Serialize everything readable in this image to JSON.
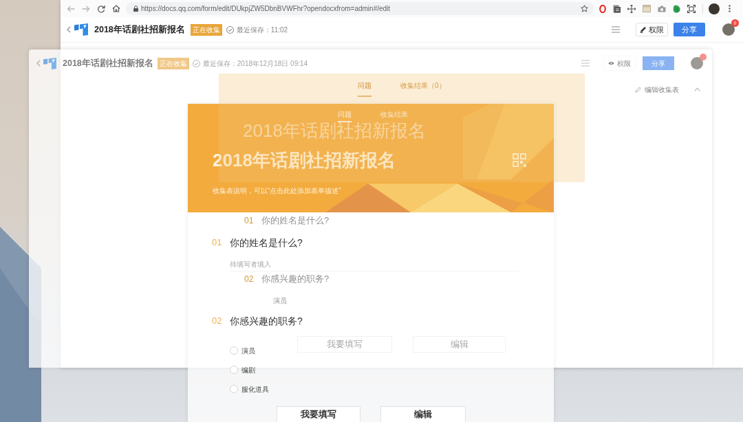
{
  "browser": {
    "url": "https://docs.qq.com/form/edit/DUkpjZW5DbnBVWFhr?opendocxfrom=admin#/edit"
  },
  "doc_header": {
    "title": "2018年话剧社招新报名",
    "badge": "正在收集",
    "save_status": "最近保存：11:02",
    "permission_button": "权限",
    "share_button": "分享",
    "notification_count": "0"
  },
  "previous_view": {
    "header": {
      "title": "2018年话剧社招新报名",
      "badge": "正在收集",
      "save_status": "最近保存：2018年12月18日 09:14",
      "permission_button": "权限",
      "share_button": "分享"
    },
    "edit_link": "编辑收集表",
    "tabs": [
      {
        "label": "问题",
        "selected": true
      },
      {
        "label": "收集结果（0）",
        "selected": false
      }
    ],
    "form_title": "2018年话剧社招新报名",
    "questions": [
      {
        "number": "01",
        "text": "你的姓名是什么?"
      },
      {
        "number": "02",
        "text": "你感兴趣的职务?"
      }
    ],
    "options": [
      "演员"
    ],
    "buttons": [
      "我要填写",
      "编辑"
    ]
  },
  "form": {
    "tabs": [
      {
        "label": "问题",
        "selected": true
      },
      {
        "label": "收集结果",
        "selected": false
      }
    ],
    "title": "2018年话剧社招新报名",
    "description": "收集表说明，可以“点击此处添加表单描述”",
    "questions": [
      {
        "number": "01",
        "text": "你的姓名是什么?",
        "kind": "text",
        "placeholder": "待填写者填入"
      },
      {
        "number": "02",
        "text": "你感兴趣的职务?",
        "kind": "choice",
        "options": [
          {
            "label": "演员",
            "checked": false
          },
          {
            "label": "编剧",
            "checked": false
          },
          {
            "label": "服化道具",
            "checked": false
          }
        ]
      }
    ],
    "buttons": [
      "我要填写",
      "编辑"
    ]
  }
}
